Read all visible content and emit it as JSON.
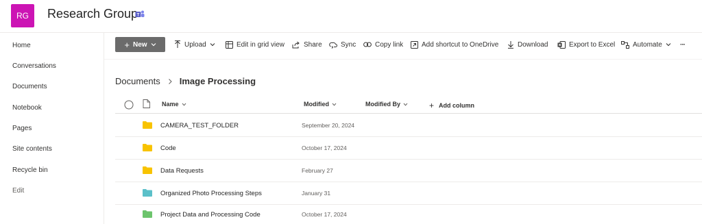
{
  "site": {
    "logo_initials": "RG",
    "logo_color": "#cc14b4",
    "title": "Research Group",
    "teams_icon": "teams-icon"
  },
  "leftnav": {
    "items": [
      {
        "label": "Home"
      },
      {
        "label": "Conversations"
      },
      {
        "label": "Documents"
      },
      {
        "label": "Notebook"
      },
      {
        "label": "Pages"
      },
      {
        "label": "Site contents"
      },
      {
        "label": "Recycle bin"
      },
      {
        "label": "Edit"
      }
    ]
  },
  "commandbar": {
    "new_label": "New",
    "items": [
      {
        "label": "Upload",
        "icon": "upload-icon"
      },
      {
        "label": "Edit in grid view",
        "icon": "grid-icon"
      },
      {
        "label": "Share",
        "icon": "share-icon"
      },
      {
        "label": "Sync",
        "icon": "sync-icon"
      },
      {
        "label": "Copy link",
        "icon": "link-icon"
      },
      {
        "label": "Add shortcut to OneDrive",
        "icon": "shortcut-icon"
      },
      {
        "label": "Download",
        "icon": "download-icon"
      },
      {
        "label": "Export to Excel",
        "icon": "excel-icon"
      },
      {
        "label": "Automate",
        "icon": "automate-icon"
      }
    ],
    "more": "···"
  },
  "breadcrumb": {
    "parent": "Documents",
    "current": "Image Processing"
  },
  "table": {
    "columns": {
      "name": "Name",
      "modified": "Modified",
      "modified_by": "Modified By",
      "add_column": "Add column"
    },
    "rows": [
      {
        "name": "CAMERA_TEST_FOLDER",
        "modified": "September 20, 2024",
        "folder_color": "#f8c300"
      },
      {
        "name": "Code",
        "modified": "October 17, 2024",
        "folder_color": "#f8c300"
      },
      {
        "name": "Data Requests",
        "modified": "February 27",
        "folder_color": "#f8c300"
      },
      {
        "name": "Organized Photo Processing Steps",
        "modified": "January 31",
        "folder_color": "#5bc0c9"
      },
      {
        "name": "Project Data and Processing Code",
        "modified": "October 17, 2024",
        "folder_color": "#6cc46c"
      }
    ]
  }
}
